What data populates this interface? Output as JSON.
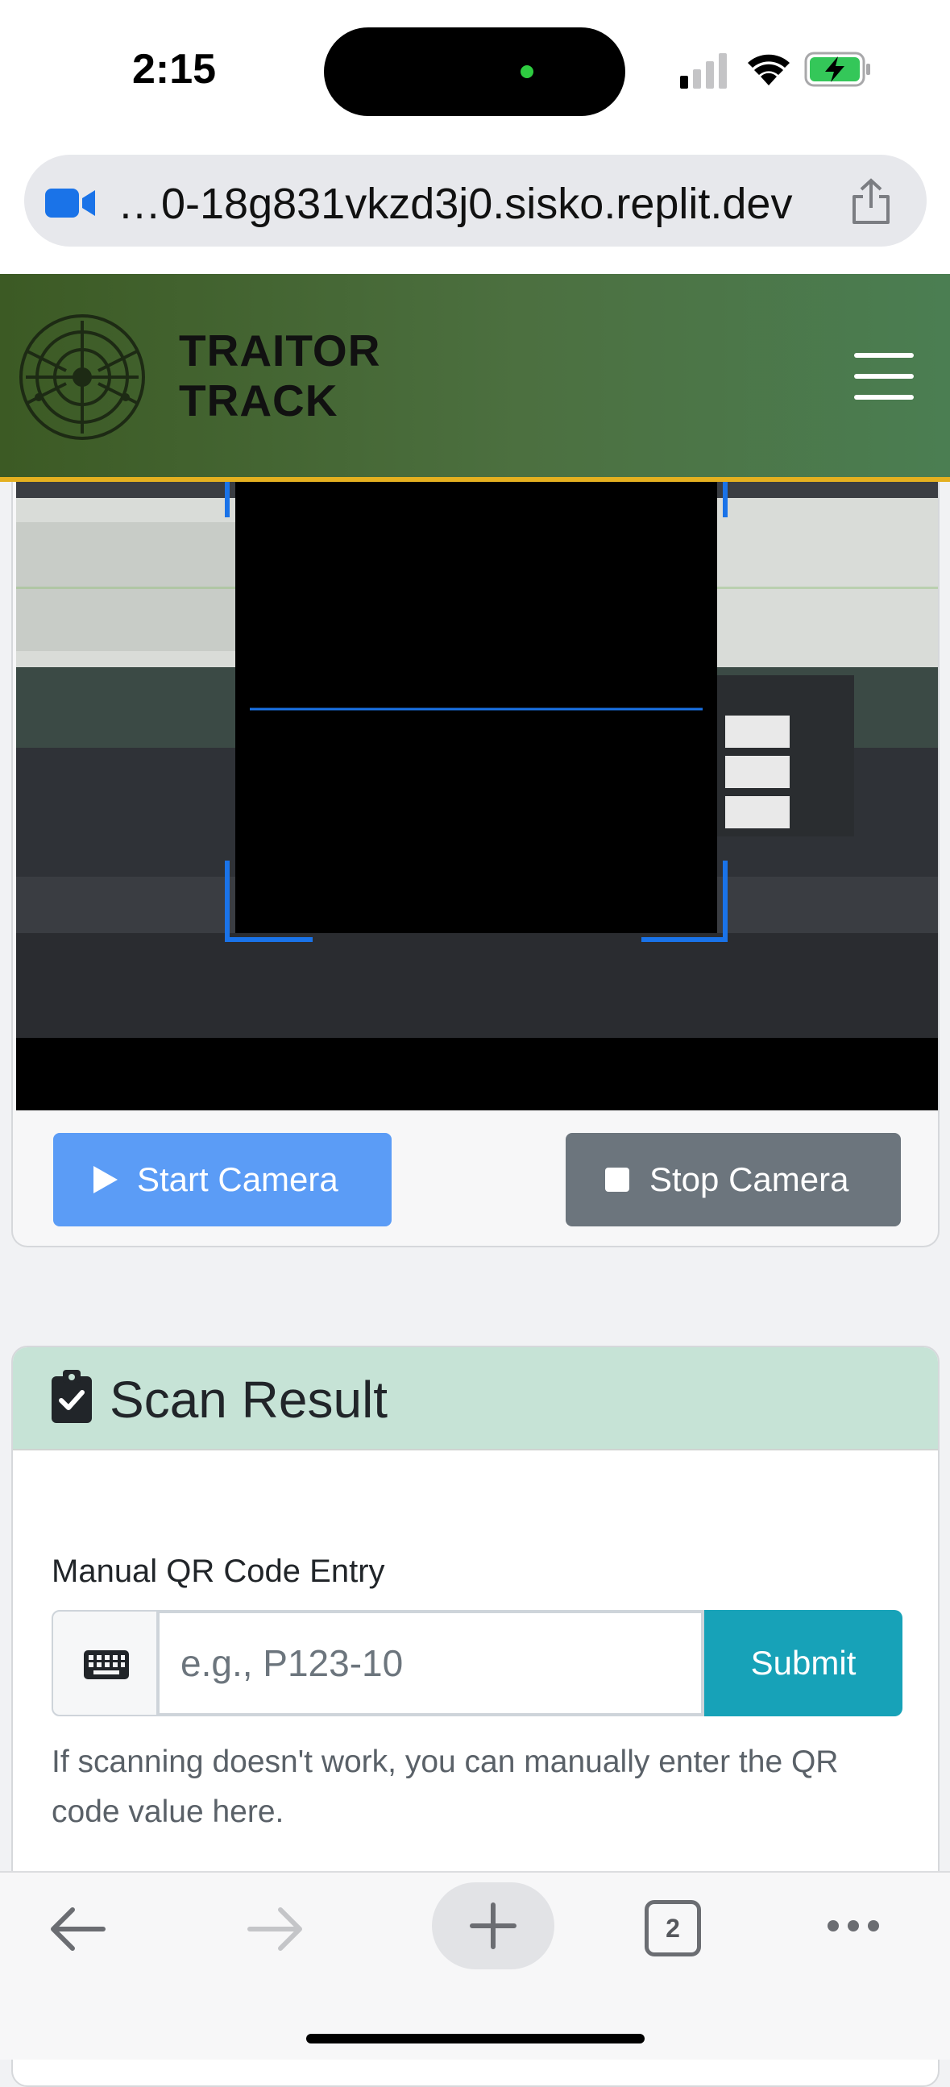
{
  "status_bar": {
    "time": "2:15"
  },
  "browser": {
    "url": "…0-18g831vkzd3j0.sisko.replit.dev",
    "tab_count": "2"
  },
  "header": {
    "brand_line1": "TRAITOR",
    "brand_line2": "TRACK"
  },
  "camera": {
    "start_label": "Start Camera",
    "stop_label": "Stop Camera"
  },
  "result": {
    "title": "Scan Result",
    "manual_label": "Manual QR Code Entry",
    "input_value": "",
    "input_placeholder": "e.g., P123-10",
    "submit_label": "Submit",
    "help_text": "If scanning doesn't work, you can manually enter the QR code value here."
  },
  "colors": {
    "header_green": "#4c7040",
    "header_border": "#e4b020",
    "start_button": "#5b9cf6",
    "stop_button": "#6c757d",
    "submit_button": "#17a2b8",
    "result_header": "#c6e3d6",
    "scan_frame": "#1a73e8"
  },
  "icons": {
    "url_icon": "video-camera-icon",
    "share": "share-icon",
    "menu": "hamburger-menu-icon",
    "start": "play-icon",
    "stop": "stop-icon",
    "result": "clipboard-check-icon",
    "keyboard": "keyboard-icon",
    "back": "back-arrow-icon",
    "forward": "forward-arrow-icon",
    "new_tab": "plus-icon",
    "more": "more-icon"
  }
}
